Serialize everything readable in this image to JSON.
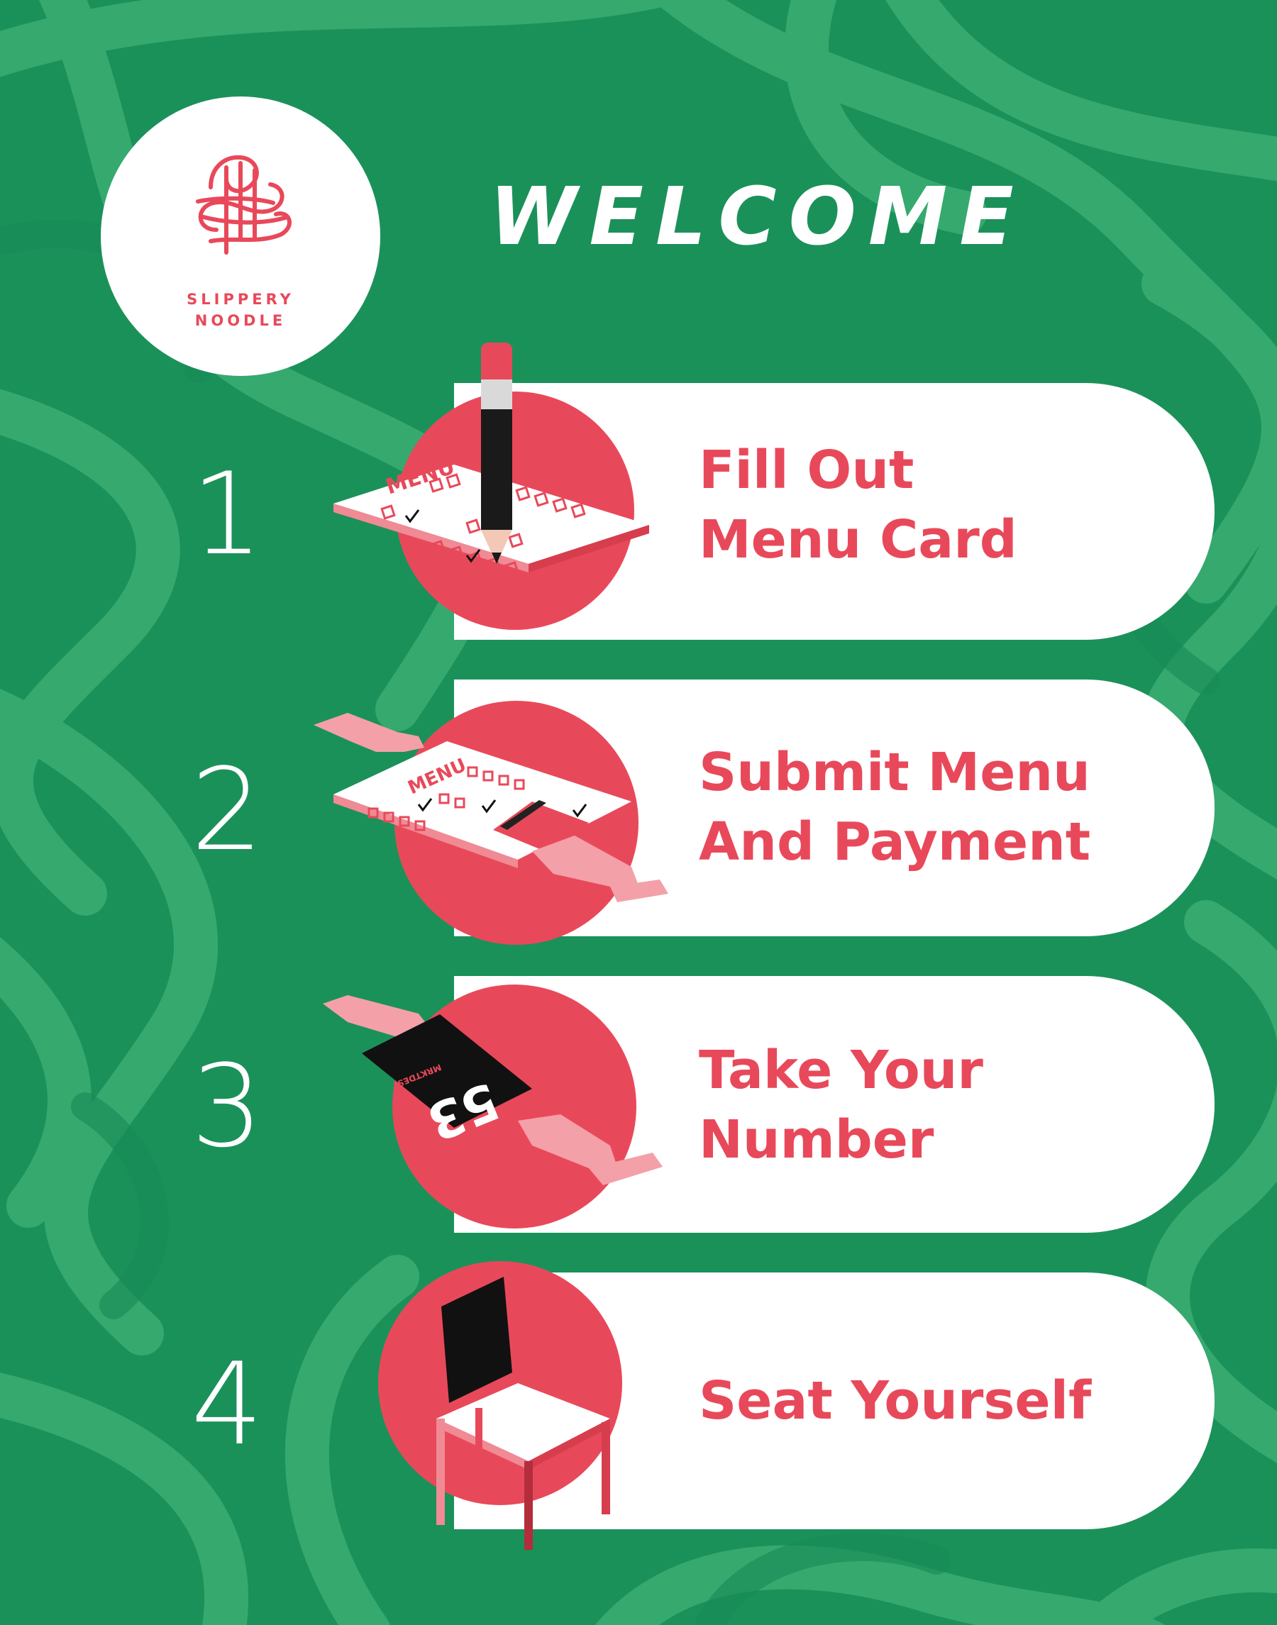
{
  "brand": {
    "line1": "SLIPPERY",
    "line2": "NOODLE",
    "primary_color": "#e8495a",
    "background_color": "#1b915a",
    "pattern_color": "#36a96f"
  },
  "header": {
    "title": "WELCOME"
  },
  "steps": [
    {
      "number": "1",
      "line1": "Fill Out",
      "line2": "Menu Card",
      "icon": "pencil-menu-card"
    },
    {
      "number": "2",
      "line1": "Submit Menu",
      "line2": "And Payment",
      "icon": "hands-menu-payment-card"
    },
    {
      "number": "3",
      "line1": "Take Your",
      "line2": "Number",
      "icon": "hands-number-tag"
    },
    {
      "number": "4",
      "line1": "Seat Yourself",
      "line2": "",
      "icon": "chair"
    }
  ],
  "illustration_text": {
    "menu_word": "MENU",
    "tag_number": "53",
    "tag_brand": "MRKTDEST"
  }
}
